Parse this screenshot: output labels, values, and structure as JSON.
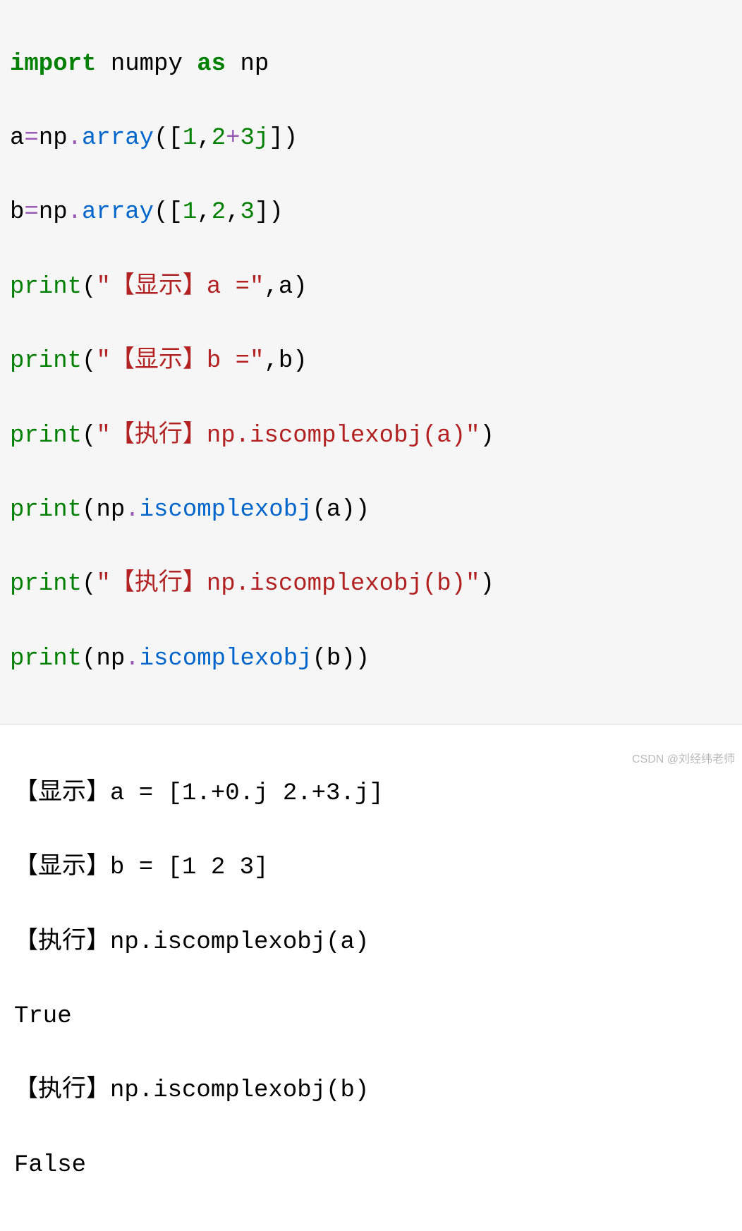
{
  "code": {
    "l1": {
      "import": "import",
      "numpy": " numpy ",
      "as": "as",
      "np": " np"
    },
    "l2": {
      "a": "a",
      "eq": "=",
      "np": "np",
      "dot": ".",
      "array": "array",
      "open": "([",
      "n1": "1",
      "c": ",",
      "n2": "2",
      "plus": "+",
      "n3": "3j",
      "close": "])"
    },
    "l3": {
      "b": "b",
      "eq": "=",
      "np": "np",
      "dot": ".",
      "array": "array",
      "open": "([",
      "n1": "1",
      "c1": ",",
      "n2": "2",
      "c2": ",",
      "n3": "3",
      "close": "])"
    },
    "l4": {
      "print": "print",
      "open": "(",
      "str": "\"【显示】a =\"",
      "c": ",",
      "a": "a",
      "close": ")"
    },
    "l5": {
      "print": "print",
      "open": "(",
      "str": "\"【显示】b =\"",
      "c": ",",
      "b": "b",
      "close": ")"
    },
    "l6": {
      "print": "print",
      "open": "(",
      "str": "\"【执行】np.iscomplexobj(a)\"",
      "close": ")"
    },
    "l7": {
      "print": "print",
      "open": "(",
      "np": "np",
      "dot": ".",
      "fn": "iscomplexobj",
      "po": "(",
      "a": "a",
      "pc": ")",
      "close": ")"
    },
    "l8": {
      "print": "print",
      "open": "(",
      "str": "\"【执行】np.iscomplexobj(b)\"",
      "close": ")"
    },
    "l9": {
      "print": "print",
      "open": "(",
      "np": "np",
      "dot": ".",
      "fn": "iscomplexobj",
      "po": "(",
      "b": "b",
      "pc": ")",
      "close": ")"
    }
  },
  "output": {
    "o1": "【显示】a = [1.+0.j 2.+3.j]",
    "o2": "【显示】b = [1 2 3]",
    "o3": "【执行】np.iscomplexobj(a)",
    "o4": "True",
    "o5": "【执行】np.iscomplexobj(b)",
    "o6": "False"
  },
  "watermark": "CSDN @刘经纬老师"
}
